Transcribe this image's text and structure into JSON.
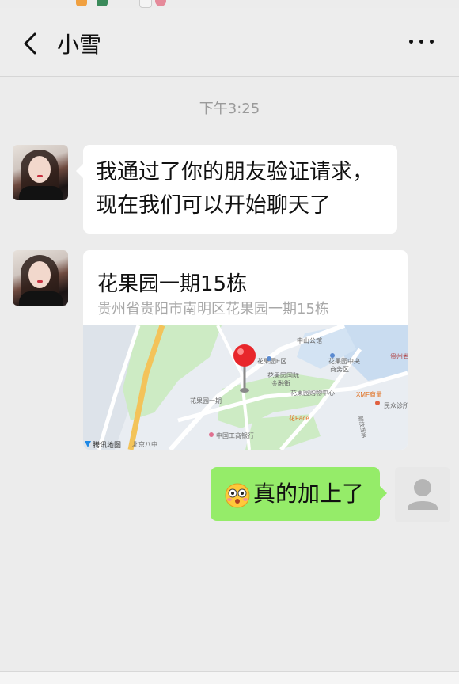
{
  "header": {
    "title": "小雪"
  },
  "chat": {
    "timestamp": "下午3:25",
    "messages": [
      {
        "sender": "contact",
        "lines": [
          "我通过了你的朋友验证请求，",
          "现在我们可以开始聊天了"
        ]
      },
      {
        "sender": "contact",
        "type": "location",
        "title": "花果园一期15栋",
        "address": "贵州省贵阳市南明区花果园一期15栋",
        "map_labels": {
          "provider": "腾讯地图",
          "poi": [
            "中山公馆",
            "花果园E区",
            "花果园中央商务区",
            "花果园国际金融街",
            "花果园购物中心",
            "XMF商量",
            "民众诊所",
            "花果园一期",
            "中国工商银行",
            "北京八中",
            "贵州省",
            "解放西路",
            "花Face"
          ]
        }
      },
      {
        "sender": "self",
        "text": "真的加上了",
        "emoji": "flushed-face"
      }
    ]
  },
  "colors": {
    "background": "#ececec",
    "bubble_self": "#95ec69",
    "bubble_contact": "#ffffff",
    "timestamp": "#9a9a9a"
  }
}
